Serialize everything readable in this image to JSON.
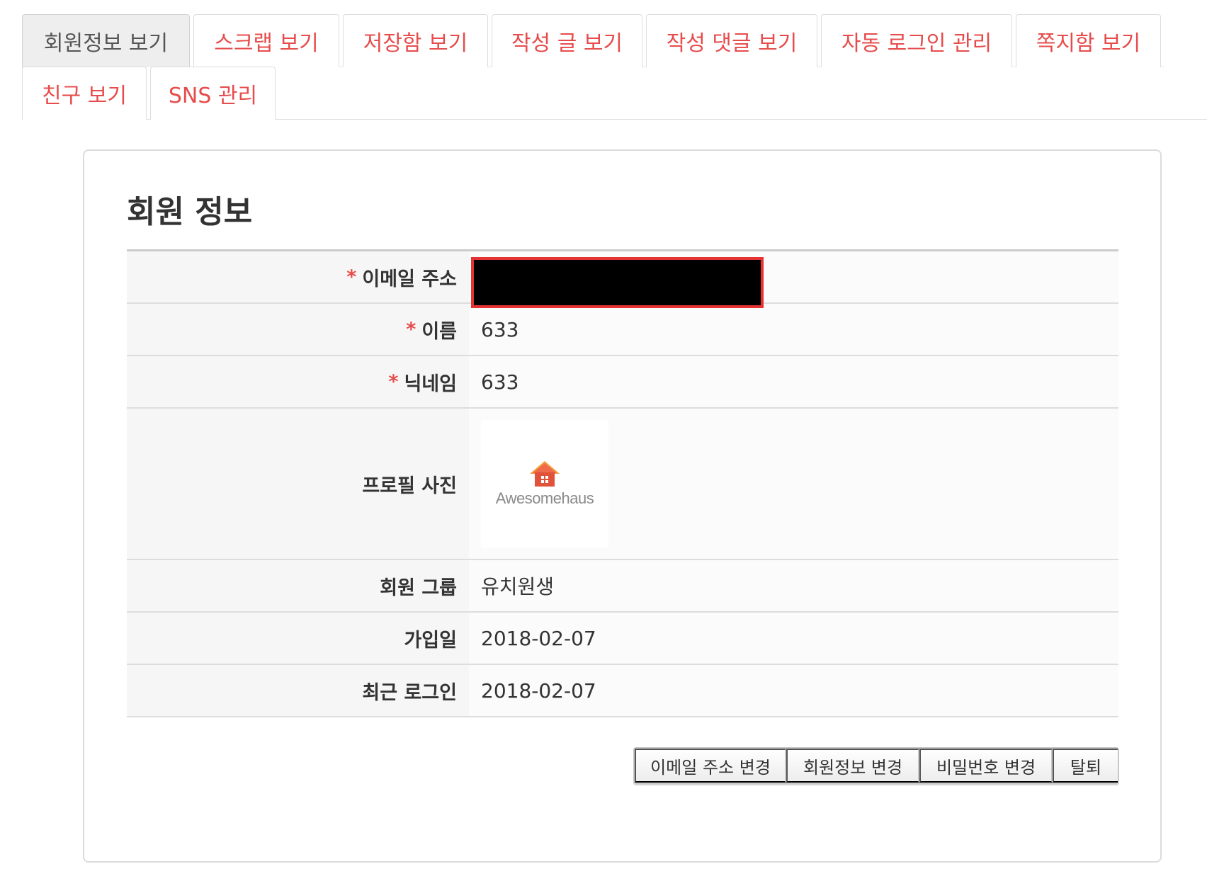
{
  "tabs": {
    "row1": [
      {
        "label": "회원정보 보기",
        "active": true
      },
      {
        "label": "스크랩 보기",
        "active": false
      },
      {
        "label": "저장함 보기",
        "active": false
      },
      {
        "label": "작성 글 보기",
        "active": false
      },
      {
        "label": "작성 댓글 보기",
        "active": false
      },
      {
        "label": "자동 로그인 관리",
        "active": false
      },
      {
        "label": "쪽지함 보기",
        "active": false
      }
    ],
    "row2": [
      {
        "label": "친구 보기",
        "active": false
      },
      {
        "label": "SNS 관리",
        "active": false
      }
    ]
  },
  "panel": {
    "title": "회원 정보",
    "required_mark": "*",
    "rows": {
      "email": {
        "label": "이메일 주소",
        "value": ""
      },
      "name": {
        "label": "이름",
        "value": "633"
      },
      "nickname": {
        "label": "닉네임",
        "value": "633"
      },
      "photo": {
        "label": "프로필 사진",
        "logo_text": "Awesomehaus"
      },
      "group": {
        "label": "회원 그룹",
        "value": "유치원생"
      },
      "joined": {
        "label": "가입일",
        "value": "2018-02-07"
      },
      "last_login": {
        "label": "최근 로그인",
        "value": "2018-02-07"
      }
    }
  },
  "buttons": {
    "change_email": "이메일 주소 변경",
    "change_info": "회원정보 변경",
    "change_password": "비밀번호 변경",
    "withdraw": "탈퇴"
  },
  "colors": {
    "tab_text": "#e74c4c",
    "required_mark": "#e74c4c",
    "redaction_border": "#e53333",
    "logo_roof": "#ef6a4a"
  },
  "icons": {
    "logo": "house-icon"
  }
}
